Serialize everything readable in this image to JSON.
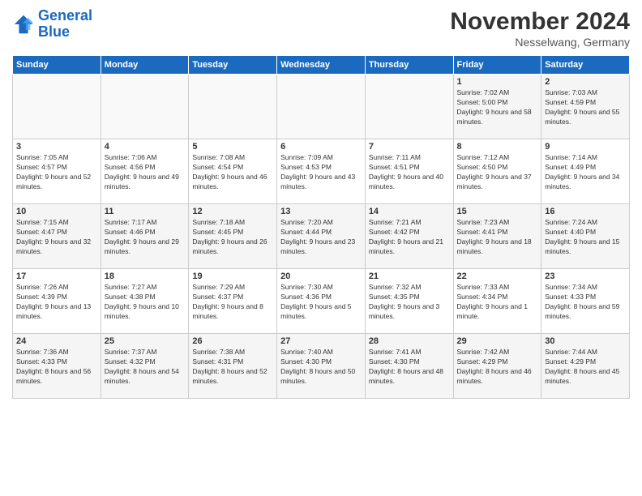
{
  "logo": {
    "line1": "General",
    "line2": "Blue"
  },
  "title": "November 2024",
  "subtitle": "Nesselwang, Germany",
  "days_header": [
    "Sunday",
    "Monday",
    "Tuesday",
    "Wednesday",
    "Thursday",
    "Friday",
    "Saturday"
  ],
  "weeks": [
    [
      {
        "day": "",
        "info": ""
      },
      {
        "day": "",
        "info": ""
      },
      {
        "day": "",
        "info": ""
      },
      {
        "day": "",
        "info": ""
      },
      {
        "day": "",
        "info": ""
      },
      {
        "day": "1",
        "info": "Sunrise: 7:02 AM\nSunset: 5:00 PM\nDaylight: 9 hours and 58 minutes."
      },
      {
        "day": "2",
        "info": "Sunrise: 7:03 AM\nSunset: 4:59 PM\nDaylight: 9 hours and 55 minutes."
      }
    ],
    [
      {
        "day": "3",
        "info": "Sunrise: 7:05 AM\nSunset: 4:57 PM\nDaylight: 9 hours and 52 minutes."
      },
      {
        "day": "4",
        "info": "Sunrise: 7:06 AM\nSunset: 4:56 PM\nDaylight: 9 hours and 49 minutes."
      },
      {
        "day": "5",
        "info": "Sunrise: 7:08 AM\nSunset: 4:54 PM\nDaylight: 9 hours and 46 minutes."
      },
      {
        "day": "6",
        "info": "Sunrise: 7:09 AM\nSunset: 4:53 PM\nDaylight: 9 hours and 43 minutes."
      },
      {
        "day": "7",
        "info": "Sunrise: 7:11 AM\nSunset: 4:51 PM\nDaylight: 9 hours and 40 minutes."
      },
      {
        "day": "8",
        "info": "Sunrise: 7:12 AM\nSunset: 4:50 PM\nDaylight: 9 hours and 37 minutes."
      },
      {
        "day": "9",
        "info": "Sunrise: 7:14 AM\nSunset: 4:49 PM\nDaylight: 9 hours and 34 minutes."
      }
    ],
    [
      {
        "day": "10",
        "info": "Sunrise: 7:15 AM\nSunset: 4:47 PM\nDaylight: 9 hours and 32 minutes."
      },
      {
        "day": "11",
        "info": "Sunrise: 7:17 AM\nSunset: 4:46 PM\nDaylight: 9 hours and 29 minutes."
      },
      {
        "day": "12",
        "info": "Sunrise: 7:18 AM\nSunset: 4:45 PM\nDaylight: 9 hours and 26 minutes."
      },
      {
        "day": "13",
        "info": "Sunrise: 7:20 AM\nSunset: 4:44 PM\nDaylight: 9 hours and 23 minutes."
      },
      {
        "day": "14",
        "info": "Sunrise: 7:21 AM\nSunset: 4:42 PM\nDaylight: 9 hours and 21 minutes."
      },
      {
        "day": "15",
        "info": "Sunrise: 7:23 AM\nSunset: 4:41 PM\nDaylight: 9 hours and 18 minutes."
      },
      {
        "day": "16",
        "info": "Sunrise: 7:24 AM\nSunset: 4:40 PM\nDaylight: 9 hours and 15 minutes."
      }
    ],
    [
      {
        "day": "17",
        "info": "Sunrise: 7:26 AM\nSunset: 4:39 PM\nDaylight: 9 hours and 13 minutes."
      },
      {
        "day": "18",
        "info": "Sunrise: 7:27 AM\nSunset: 4:38 PM\nDaylight: 9 hours and 10 minutes."
      },
      {
        "day": "19",
        "info": "Sunrise: 7:29 AM\nSunset: 4:37 PM\nDaylight: 9 hours and 8 minutes."
      },
      {
        "day": "20",
        "info": "Sunrise: 7:30 AM\nSunset: 4:36 PM\nDaylight: 9 hours and 5 minutes."
      },
      {
        "day": "21",
        "info": "Sunrise: 7:32 AM\nSunset: 4:35 PM\nDaylight: 9 hours and 3 minutes."
      },
      {
        "day": "22",
        "info": "Sunrise: 7:33 AM\nSunset: 4:34 PM\nDaylight: 9 hours and 1 minute."
      },
      {
        "day": "23",
        "info": "Sunrise: 7:34 AM\nSunset: 4:33 PM\nDaylight: 8 hours and 59 minutes."
      }
    ],
    [
      {
        "day": "24",
        "info": "Sunrise: 7:36 AM\nSunset: 4:33 PM\nDaylight: 8 hours and 56 minutes."
      },
      {
        "day": "25",
        "info": "Sunrise: 7:37 AM\nSunset: 4:32 PM\nDaylight: 8 hours and 54 minutes."
      },
      {
        "day": "26",
        "info": "Sunrise: 7:38 AM\nSunset: 4:31 PM\nDaylight: 8 hours and 52 minutes."
      },
      {
        "day": "27",
        "info": "Sunrise: 7:40 AM\nSunset: 4:30 PM\nDaylight: 8 hours and 50 minutes."
      },
      {
        "day": "28",
        "info": "Sunrise: 7:41 AM\nSunset: 4:30 PM\nDaylight: 8 hours and 48 minutes."
      },
      {
        "day": "29",
        "info": "Sunrise: 7:42 AM\nSunset: 4:29 PM\nDaylight: 8 hours and 46 minutes."
      },
      {
        "day": "30",
        "info": "Sunrise: 7:44 AM\nSunset: 4:29 PM\nDaylight: 8 hours and 45 minutes."
      }
    ]
  ]
}
